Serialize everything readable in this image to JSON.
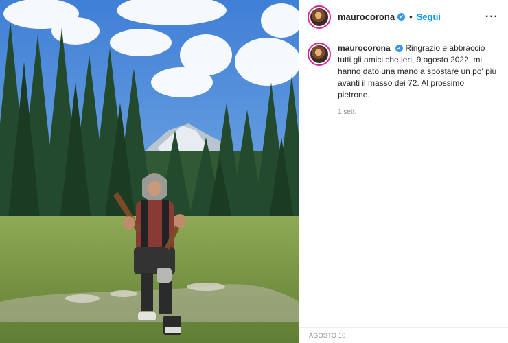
{
  "post": {
    "username": "maurocorona",
    "separator": "•",
    "follow_label": "Segui",
    "more_label": "···",
    "verified_mark": "✔",
    "caption_text": "Ringrazio e abbraccio tutti gli amici che ieri, 9 agosto 2022, mi hanno dato una mano a spostare un po' più avanti il masso dei 72. Al prossimo pietrone.",
    "relative_time": "1 sett.",
    "date": "AGOSTO 10"
  },
  "icons": {
    "verified": "verified-badge-icon",
    "more": "more-options-icon"
  },
  "colors": {
    "follow": "#0095f6",
    "verified": "#3897f0",
    "avatar_ring": "#d6249f",
    "meta": "#8e8e8e"
  }
}
